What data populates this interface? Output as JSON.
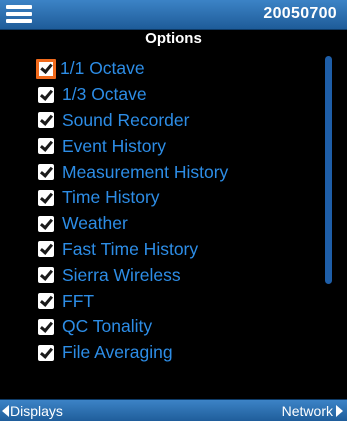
{
  "header": {
    "serial": "20050700"
  },
  "title": "Options",
  "options": [
    {
      "label": "1/1 Octave",
      "checked": true,
      "focused": true
    },
    {
      "label": "1/3 Octave",
      "checked": true,
      "focused": false
    },
    {
      "label": "Sound Recorder",
      "checked": true,
      "focused": false
    },
    {
      "label": "Event History",
      "checked": true,
      "focused": false
    },
    {
      "label": "Measurement History",
      "checked": true,
      "focused": false
    },
    {
      "label": "Time History",
      "checked": true,
      "focused": false
    },
    {
      "label": "Weather",
      "checked": true,
      "focused": false
    },
    {
      "label": "Fast Time History",
      "checked": true,
      "focused": false
    },
    {
      "label": "Sierra Wireless",
      "checked": true,
      "focused": false
    },
    {
      "label": "FFT",
      "checked": true,
      "focused": false
    },
    {
      "label": "QC Tonality",
      "checked": true,
      "focused": false
    },
    {
      "label": "File Averaging",
      "checked": true,
      "focused": false
    }
  ],
  "footer": {
    "left_label": "Displays",
    "right_label": "Network"
  },
  "icons": {
    "menu": "hamburger-icon",
    "back": "left-triangle-icon",
    "forward": "right-triangle-icon",
    "check": "checkmark-icon"
  },
  "colors": {
    "bar": "#2a6fb3",
    "item_text": "#2d8de6",
    "focus": "#f06a1c",
    "background": "#000000",
    "scrollbar": "#1e5ea8"
  }
}
